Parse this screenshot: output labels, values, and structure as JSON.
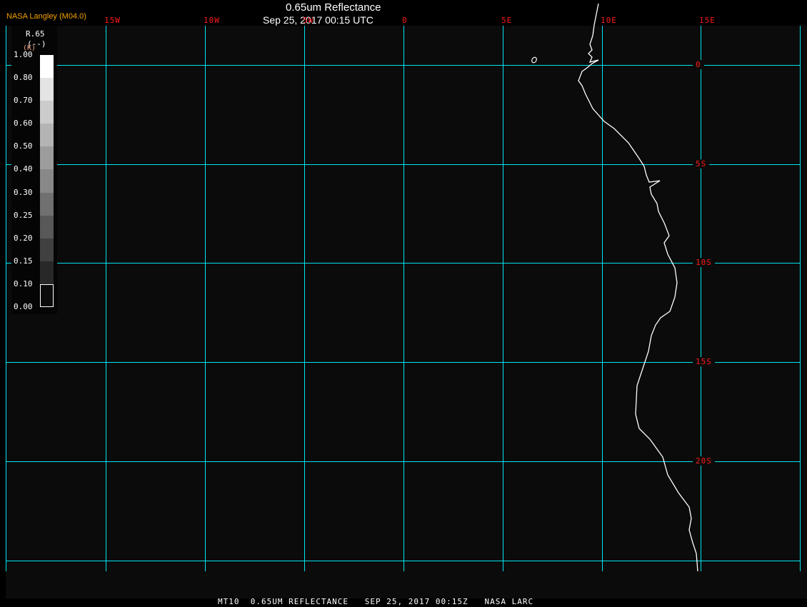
{
  "header": {
    "credit": "NASA Langley (M04.0)",
    "title": "0.65um Reflectance",
    "datetime": "Sep 25, 2017 00:15 UTC"
  },
  "map": {
    "longitude_labels": [
      "15W",
      "10W",
      "5W",
      "0",
      "5E",
      "10E",
      "15E"
    ],
    "latitude_labels": [
      "0",
      "5S",
      "10S",
      "15S",
      "20S"
    ],
    "grid_color": "#00e5ee",
    "label_color": "#ff1a1a",
    "coastline_color": "#ffffff",
    "background_color": "#0b0b0b"
  },
  "colorbar": {
    "variable": "R.65",
    "units": "(--)",
    "sub_units": "(K)",
    "ticks": [
      "1.00",
      "0.80",
      "0.70",
      "0.60",
      "0.50",
      "0.40",
      "0.30",
      "0.25",
      "0.20",
      "0.15",
      "0.10",
      "0.00"
    ],
    "colors": [
      "#ffffff",
      "#e4e4e4",
      "#cccccc",
      "#b4b4b4",
      "#9c9c9c",
      "#888888",
      "#707070",
      "#585858",
      "#404040",
      "#282828",
      "#0b0b0b"
    ]
  },
  "footer": {
    "text": "MT10  0.65UM REFLECTANCE   SEP 25, 2017 00:15Z   NASA LARC"
  }
}
